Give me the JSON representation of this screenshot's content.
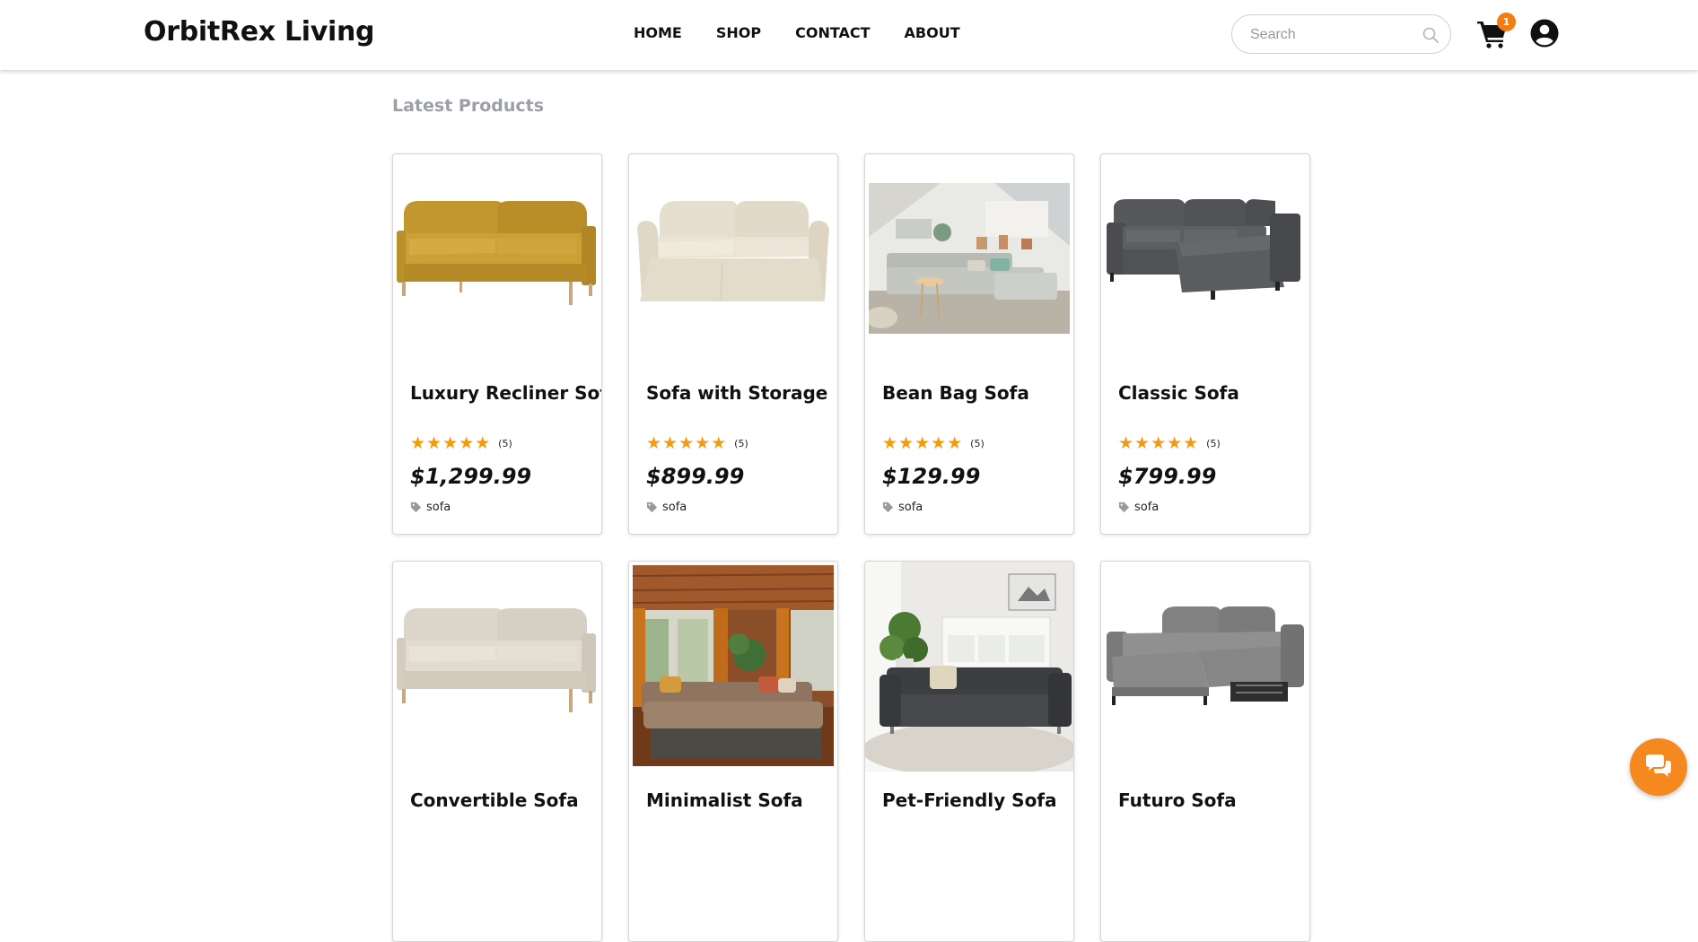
{
  "brand": "OrbitRex Living",
  "nav": [
    "HOME",
    "SHOP",
    "CONTACT",
    "ABOUT"
  ],
  "search": {
    "placeholder": "Search"
  },
  "cart": {
    "count": "1"
  },
  "section_title": "Latest Products",
  "colors": {
    "accent": "#f47c14",
    "star": "#f49b0d",
    "title_muted": "#9aa0a6"
  },
  "products": [
    {
      "name": "Luxury Recliner Sofa",
      "stars": "★★★★★",
      "rating_count": "(5)",
      "price": "$1,299.99",
      "tag": "sofa",
      "image": "mustard-two-seat-sofa"
    },
    {
      "name": "Sofa with Storage",
      "stars": "★★★★★",
      "rating_count": "(5)",
      "price": "$899.99",
      "tag": "sofa",
      "image": "cream-slipcover-sofa"
    },
    {
      "name": "Bean Bag Sofa",
      "stars": "★★★★★",
      "rating_count": "(5)",
      "price": "$129.99",
      "tag": "sofa",
      "image": "grey-sectional-living-room-photo"
    },
    {
      "name": "Classic Sofa",
      "stars": "★★★★★",
      "rating_count": "(5)",
      "price": "$799.99",
      "tag": "sofa",
      "image": "dark-grey-chaise-sofa"
    },
    {
      "name": "Convertible Sofa",
      "image": "beige-two-seat-sofa"
    },
    {
      "name": "Minimalist Sofa",
      "image": "brown-sectional-wood-room-photo"
    },
    {
      "name": "Pet-Friendly Sofa",
      "image": "black-sofa-white-room-photo"
    },
    {
      "name": "Futuro Sofa",
      "image": "grey-sofa-bed"
    }
  ]
}
